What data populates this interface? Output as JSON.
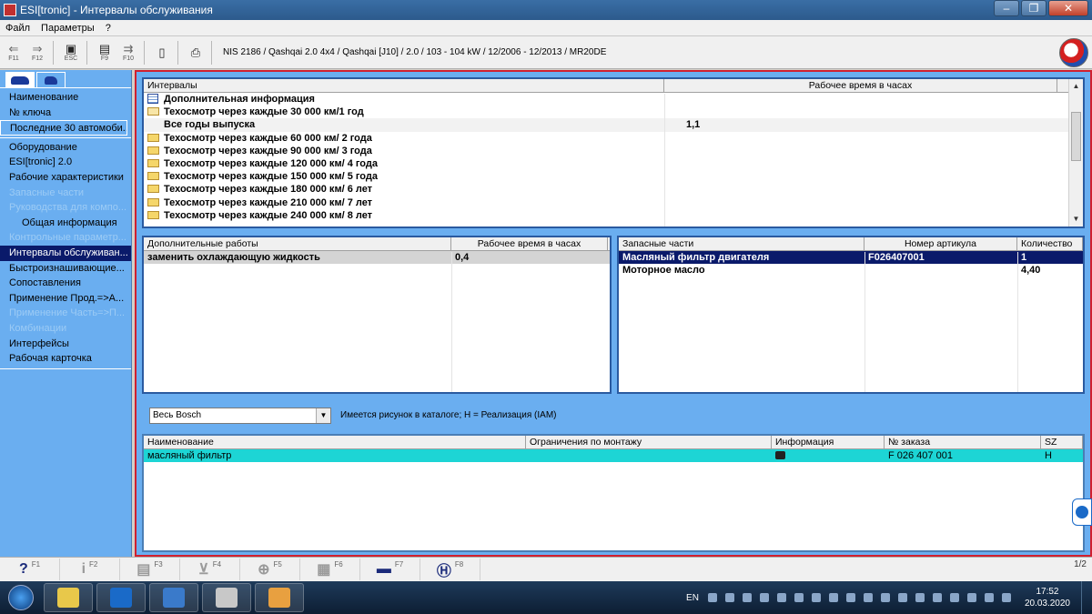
{
  "window": {
    "title": "ESI[tronic] - Интервалы обслуживания"
  },
  "menu": [
    "Файл",
    "Параметры",
    "?"
  ],
  "toolbar": {
    "buttons": [
      {
        "icon": "arrow-left-icon",
        "key": "F11"
      },
      {
        "icon": "arrow-right-icon",
        "key": "F12"
      },
      {
        "icon": "exit-icon",
        "key": "ESC"
      },
      {
        "icon": "print-preview-icon",
        "key": "F9"
      },
      {
        "icon": "forward-icon",
        "key": "F10"
      }
    ],
    "vehicle": "NIS 2186 / Qashqai 2.0 4x4 / Qashqai [J10] / 2.0 / 103 - 104 kW / 12/2006 - 12/2013 / MR20DE",
    "logo": "BOSCH"
  },
  "sidebar": {
    "group1": [
      "Наименование",
      "№ ключа",
      "Последние 30 автомоби..."
    ],
    "group2": [
      {
        "label": "Оборудование",
        "state": "normal"
      },
      {
        "label": "ESI[tronic] 2.0",
        "state": "normal"
      },
      {
        "label": "Рабочие характеристики",
        "state": "normal"
      },
      {
        "label": "Запасные части",
        "state": "disabled"
      },
      {
        "label": "Руководства для компо...",
        "state": "disabled"
      },
      {
        "label": "Общая информация",
        "state": "sub"
      },
      {
        "label": "Контрольные параметр...",
        "state": "disabled"
      },
      {
        "label": "Интервалы обслуживан...",
        "state": "selected"
      },
      {
        "label": "Быстроизнашивающие...",
        "state": "normal"
      },
      {
        "label": "Сопоставления",
        "state": "normal"
      },
      {
        "label": "Применение Прод.=>А...",
        "state": "normal"
      },
      {
        "label": "Применение Часть=>П...",
        "state": "disabled"
      },
      {
        "label": "Комбинации",
        "state": "disabled"
      },
      {
        "label": "Интерфейсы",
        "state": "normal"
      },
      {
        "label": "Рабочая карточка",
        "state": "normal"
      }
    ]
  },
  "intervals": {
    "headers": [
      "Интервалы",
      "Рабочее время в часах"
    ],
    "rows": [
      {
        "label": "Дополнительная информация",
        "icon": "info",
        "time": ""
      },
      {
        "label": "Техосмотр через каждые 30 000 км/1 год",
        "icon": "open-folder",
        "time": ""
      },
      {
        "label": "Все годы выпуска",
        "icon": "none",
        "time": "1,1",
        "highlight": true
      },
      {
        "label": "Техосмотр через каждые 60 000 км/ 2 года",
        "icon": "folder",
        "time": ""
      },
      {
        "label": "Техосмотр через каждые 90 000 км/ 3 года",
        "icon": "folder",
        "time": ""
      },
      {
        "label": "Техосмотр через каждые 120 000 км/ 4 года",
        "icon": "folder",
        "time": ""
      },
      {
        "label": "Техосмотр через каждые 150 000 км/ 5 года",
        "icon": "folder",
        "time": ""
      },
      {
        "label": "Техосмотр через каждые 180 000 км/ 6 лет",
        "icon": "folder",
        "time": ""
      },
      {
        "label": "Техосмотр через каждые 210 000 км/ 7 лет",
        "icon": "folder",
        "time": ""
      },
      {
        "label": "Техосмотр через каждые 240 000 км/ 8 лет",
        "icon": "folder",
        "time": ""
      }
    ]
  },
  "extra_work": {
    "headers": [
      "Дополнительные работы",
      "Рабочее время в часах"
    ],
    "rows": [
      {
        "label": "заменить охлаждающую жидкость",
        "time": "0,4"
      }
    ]
  },
  "spare_parts": {
    "headers": [
      "Запасные части",
      "Номер артикула",
      "Количество"
    ],
    "rows": [
      {
        "name": "Масляный фильтр двигателя",
        "article": "F026407001",
        "qty": "1"
      },
      {
        "name": "Моторное масло",
        "article": "",
        "qty": "4,40"
      }
    ]
  },
  "filter": {
    "selected": "Весь Bosch",
    "hint": "Имеется рисунок в каталоге; H = Реализация (IAM)"
  },
  "products": {
    "headers": [
      "Наименование",
      "Ограничения по монтажу",
      "Информация",
      "№ заказа",
      "SZ"
    ],
    "rows": [
      {
        "name": "масляный фильтр",
        "limits": "",
        "info": "camera-icon",
        "order": "F 026 407 001",
        "sz": "H"
      }
    ]
  },
  "fkeys": [
    {
      "icon": "help-icon",
      "glyph": "?",
      "key": "F1",
      "active": true
    },
    {
      "icon": "info-icon",
      "glyph": "i",
      "key": "F2",
      "active": false
    },
    {
      "icon": "calc-icon",
      "glyph": "▤",
      "key": "F3",
      "active": false
    },
    {
      "icon": "cart-icon",
      "glyph": "⊻",
      "key": "F4",
      "active": false
    },
    {
      "icon": "zoom-icon",
      "glyph": "⊕",
      "key": "F5",
      "active": false
    },
    {
      "icon": "list-icon",
      "glyph": "▦",
      "key": "F6",
      "active": false
    },
    {
      "icon": "car-icon",
      "glyph": "▬",
      "key": "F7",
      "active": true
    },
    {
      "icon": "bosch-icon",
      "glyph": "Ⓗ",
      "key": "F8",
      "active": true
    }
  ],
  "status": {
    "pages": "1/2"
  },
  "taskbar": {
    "lang": "EN",
    "time": "17:52",
    "date": "20.03.2020",
    "apps": [
      "explorer-icon",
      "teamviewer-icon",
      "car-diagnostic-icon",
      "disc-icon",
      "paint-icon"
    ],
    "app_colors": [
      "#e8c84a",
      "#1a6ac8",
      "#3a7aca",
      "#c8c8c8",
      "#e8a040"
    ]
  },
  "colors": {
    "panel_bg": "#6aaef0",
    "frame_border": "#d02030",
    "selection_dark": "#0a1a6a",
    "selection_cyan": "#1dd5d5"
  }
}
